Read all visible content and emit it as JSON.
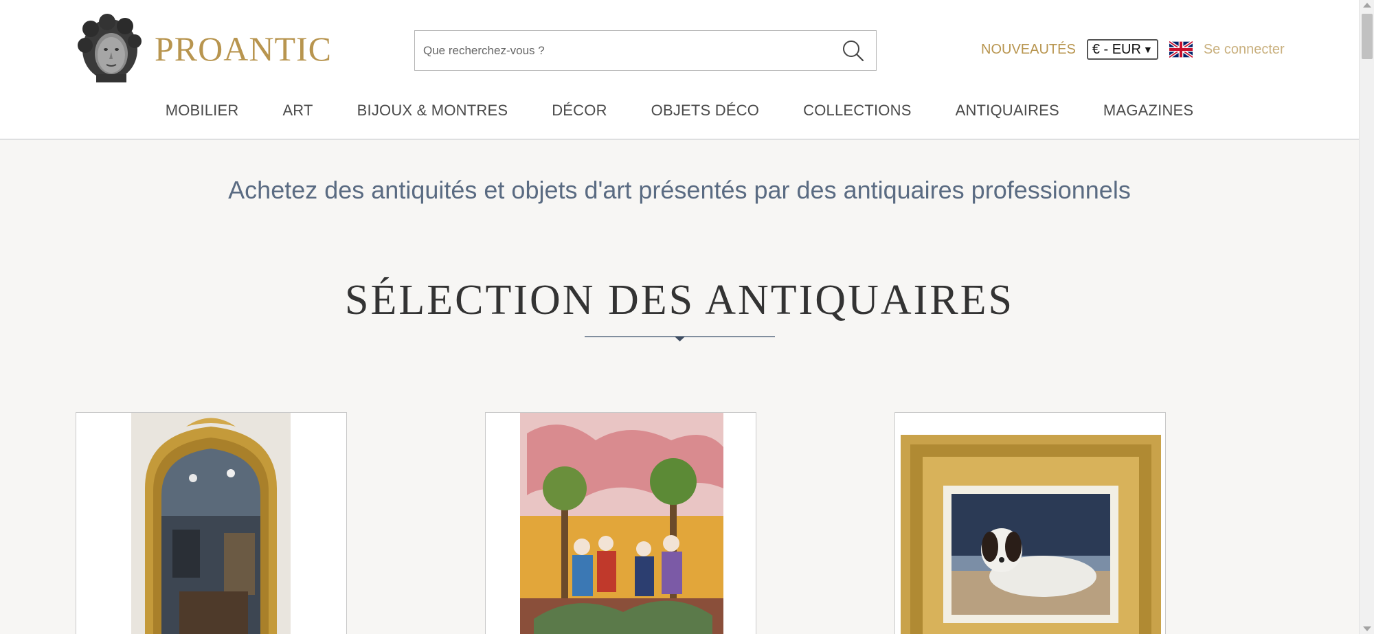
{
  "header": {
    "logo_text": "PROANTIC",
    "search_placeholder": "Que recherchez-vous ?",
    "nouveautes": "NOUVEAUTÉS",
    "currency": "€ - EUR",
    "login": "Se connecter"
  },
  "nav": [
    {
      "label": "MOBILIER"
    },
    {
      "label": "ART"
    },
    {
      "label": "BIJOUX & MONTRES"
    },
    {
      "label": "DÉCOR"
    },
    {
      "label": "OBJETS DÉCO"
    },
    {
      "label": "COLLECTIONS"
    },
    {
      "label": "ANTIQUAIRES"
    },
    {
      "label": "MAGAZINES"
    }
  ],
  "main": {
    "tagline": "Achetez des antiquités et objets d'art présentés par des antiquaires professionnels",
    "section_title": "SÉLECTION DES ANTIQUAIRES"
  },
  "colors": {
    "brand_gold": "#b8954f",
    "login_gold": "#c9b07e",
    "tagline_blue": "#5a6b82",
    "background": "#f7f6f4"
  },
  "icons": [
    "search-icon",
    "uk-flag-icon",
    "logo-head-icon",
    "chevron-down-icon"
  ]
}
